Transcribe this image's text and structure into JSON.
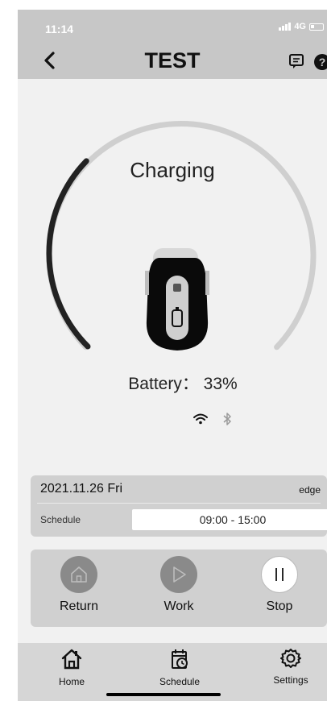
{
  "status_bar": {
    "time": "11:14",
    "network": "4G"
  },
  "header": {
    "title": "TEST",
    "help_symbol": "?"
  },
  "device": {
    "state": "Charging",
    "battery_text": "Battery： 33%",
    "battery_percent": 33,
    "wifi": "connected",
    "bluetooth": "disconnected"
  },
  "schedule": {
    "date": "2021.11.26 Fri",
    "mode": "edge",
    "label": "Schedule",
    "time_range": "09:00 - 15:00"
  },
  "controls": [
    {
      "label": "Return",
      "icon": "home-icon"
    },
    {
      "label": "Work",
      "icon": "play-icon"
    },
    {
      "label": "Stop",
      "icon": "pause-icon"
    }
  ],
  "tabs": [
    {
      "label": "Home",
      "icon": "home-icon"
    },
    {
      "label": "Schedule",
      "icon": "calendar-clock-icon"
    },
    {
      "label": "Settings",
      "icon": "gear-icon"
    }
  ],
  "colors": {
    "header_bg": "#c7c7c7",
    "background": "#f1f1f1",
    "gauge_track": "#cfcfcf",
    "gauge_fill": "#222222",
    "card_bg": "#d0d0d0"
  }
}
